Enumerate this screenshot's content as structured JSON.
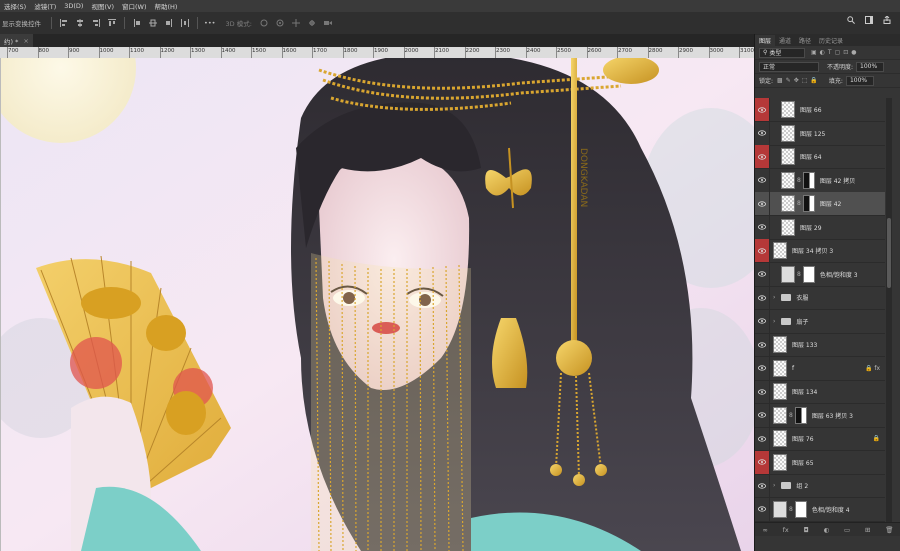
{
  "menubar": [
    "选择(S)",
    "滤镜(T)",
    "3D(D)",
    "视图(V)",
    "窗口(W)",
    "帮助(H)"
  ],
  "options_bar": {
    "show_transform_label": "显示变换控件",
    "more": "•••",
    "mode3d_label": "3D 模式:"
  },
  "document_tab": {
    "name": "约) *",
    "close": "×"
  },
  "ruler": [
    "700",
    "800",
    "900",
    "1000",
    "1100",
    "1200",
    "1300",
    "1400",
    "1500",
    "1600",
    "1700",
    "1800",
    "1900",
    "2000",
    "2100",
    "2200",
    "2300",
    "2400",
    "2500",
    "2600",
    "2700",
    "2800",
    "2900",
    "3000",
    "3100"
  ],
  "canvas": {
    "description_icon": "illustration",
    "text_on_image": "DONGKADAN"
  },
  "layers_panel": {
    "tabs": [
      "图层",
      "通道",
      "路径",
      "历史记录"
    ],
    "filter_label": "类型",
    "blend_mode": "正常",
    "opacity_label": "不透明度:",
    "opacity_value": "100%",
    "lock_label": "锁定:",
    "fill_label": "填充:",
    "fill_value": "100%",
    "layers": [
      {
        "name": "图层 66",
        "red": true,
        "kind": "thumb",
        "indent": true
      },
      {
        "name": "图层 125",
        "red": false,
        "kind": "thumb",
        "indent": true
      },
      {
        "name": "图层 64",
        "red": true,
        "kind": "thumb",
        "indent": true
      },
      {
        "name": "图层 42 拷贝",
        "red": false,
        "kind": "masked",
        "indent": true
      },
      {
        "name": "图层 42",
        "red": false,
        "kind": "masked",
        "indent": true,
        "selected": true
      },
      {
        "name": "图层 29",
        "red": false,
        "kind": "thumb",
        "indent": true
      },
      {
        "name": "图层 34 拷贝 3",
        "red": true,
        "kind": "thumb",
        "indent": false
      },
      {
        "name": "色相/饱和度 3",
        "red": false,
        "kind": "adjust",
        "indent": true
      },
      {
        "name": "衣服",
        "red": false,
        "kind": "folder",
        "indent": false
      },
      {
        "name": "扇子",
        "red": false,
        "kind": "folder",
        "indent": false
      },
      {
        "name": "图层 133",
        "red": false,
        "kind": "thumb",
        "indent": false
      },
      {
        "name": "f",
        "red": false,
        "kind": "thumb",
        "indent": false,
        "badge": "🔒 fx"
      },
      {
        "name": "图层 134",
        "red": false,
        "kind": "thumb",
        "indent": false
      },
      {
        "name": "图层 63 拷贝 3",
        "red": false,
        "kind": "masked",
        "indent": false
      },
      {
        "name": "图层 76",
        "red": false,
        "kind": "thumb",
        "indent": false,
        "badge": "🔒"
      },
      {
        "name": "图层 65",
        "red": true,
        "kind": "thumb",
        "indent": false
      },
      {
        "name": "组 2",
        "red": false,
        "kind": "folder",
        "indent": false
      },
      {
        "name": "色相/饱和度 4",
        "red": false,
        "kind": "adjust",
        "indent": false
      }
    ],
    "footer_icons": [
      "∞",
      "fx",
      "◘",
      "◐",
      "▭",
      "⊞",
      "🗑"
    ]
  }
}
